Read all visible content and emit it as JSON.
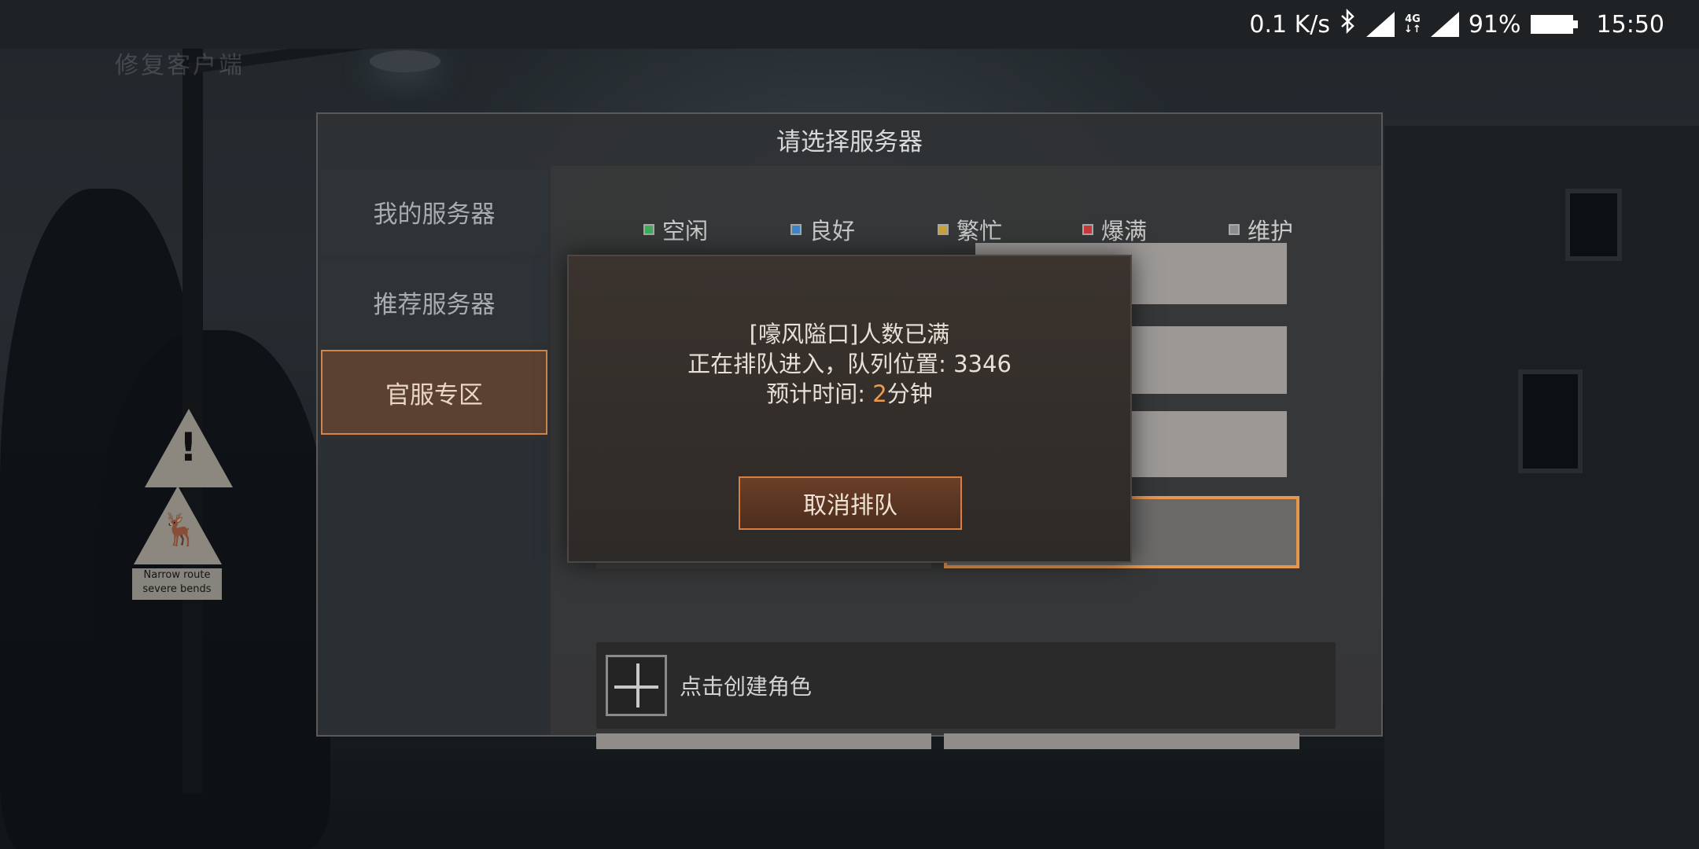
{
  "status_bar": {
    "net_speed": "0.1 K/s",
    "network_type": "4G",
    "battery": "91%",
    "time": "15:50",
    "icons": [
      "bluetooth-icon",
      "signal-icon",
      "signal-icon",
      "battery-icon"
    ]
  },
  "background": {
    "top_left_label": "修复客户端",
    "sign_plate": "Narrow route severe bends"
  },
  "panel": {
    "title": "请选择服务器",
    "tabs": [
      {
        "label": "我的服务器",
        "active": false
      },
      {
        "label": "推荐服务器",
        "active": false
      },
      {
        "label": "官服专区",
        "active": true
      }
    ],
    "legend": [
      {
        "label": "空闲",
        "color": "#3fae5b"
      },
      {
        "label": "良好",
        "color": "#3f86c8"
      },
      {
        "label": "繁忙",
        "color": "#c9a23a"
      },
      {
        "label": "爆满",
        "color": "#c83a3a"
      },
      {
        "label": "维护",
        "color": "#8d8d8d"
      }
    ],
    "create_role_label": "点击创建角色"
  },
  "popup": {
    "line1": "[嚎风隘口]人数已满",
    "line2_prefix": "正在排队进入，队列位置: ",
    "queue_position": "3346",
    "line3_prefix": "预计时间: ",
    "eta_value": "2",
    "eta_unit": "分钟",
    "cancel_label": "取消排队"
  },
  "colors": {
    "accent": "#e6974e",
    "queue_highlight": "#f09a4c"
  }
}
